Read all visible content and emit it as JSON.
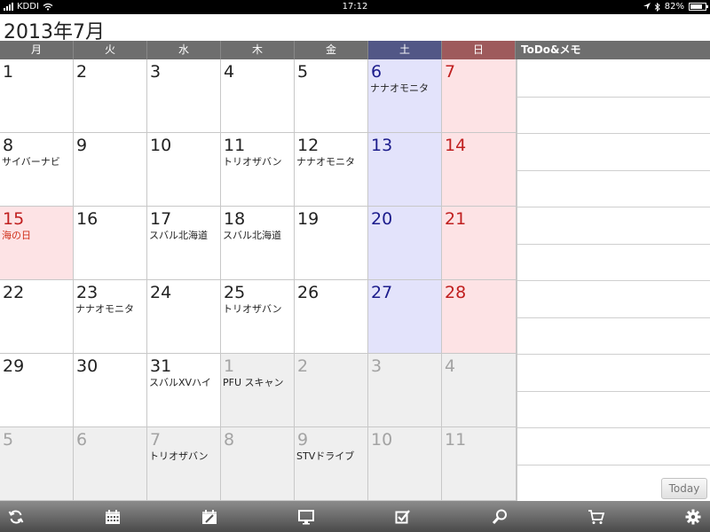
{
  "status_bar": {
    "carrier": "KDDI",
    "time": "17:12",
    "battery": "82%",
    "battery_level": 0.82
  },
  "calendar": {
    "month_title": "2013年7月",
    "weekdays": [
      "月",
      "火",
      "水",
      "木",
      "金",
      "土",
      "日"
    ],
    "memo_header": "ToDo&メモ",
    "weeks": [
      [
        {
          "day": "1",
          "event": ""
        },
        {
          "day": "2",
          "event": ""
        },
        {
          "day": "3",
          "event": ""
        },
        {
          "day": "4",
          "event": ""
        },
        {
          "day": "5",
          "event": ""
        },
        {
          "day": "6",
          "event": "ナナオモニタ"
        },
        {
          "day": "7",
          "event": ""
        }
      ],
      [
        {
          "day": "8",
          "event": "サイバーナビ"
        },
        {
          "day": "9",
          "event": ""
        },
        {
          "day": "10",
          "event": ""
        },
        {
          "day": "11",
          "event": "トリオザバン"
        },
        {
          "day": "12",
          "event": "ナナオモニタ"
        },
        {
          "day": "13",
          "event": ""
        },
        {
          "day": "14",
          "event": ""
        }
      ],
      [
        {
          "day": "15",
          "event": "海の日"
        },
        {
          "day": "16",
          "event": ""
        },
        {
          "day": "17",
          "event": "スバル北海道"
        },
        {
          "day": "18",
          "event": "スバル北海道"
        },
        {
          "day": "19",
          "event": ""
        },
        {
          "day": "20",
          "event": ""
        },
        {
          "day": "21",
          "event": ""
        }
      ],
      [
        {
          "day": "22",
          "event": ""
        },
        {
          "day": "23",
          "event": "ナナオモニタ"
        },
        {
          "day": "24",
          "event": ""
        },
        {
          "day": "25",
          "event": "トリオザバン"
        },
        {
          "day": "26",
          "event": ""
        },
        {
          "day": "27",
          "event": ""
        },
        {
          "day": "28",
          "event": ""
        }
      ],
      [
        {
          "day": "29",
          "event": ""
        },
        {
          "day": "30",
          "event": ""
        },
        {
          "day": "31",
          "event": "スバルXVハイ"
        },
        {
          "day": "1",
          "event": "PFU スキャン"
        },
        {
          "day": "2",
          "event": ""
        },
        {
          "day": "3",
          "event": ""
        },
        {
          "day": "4",
          "event": ""
        }
      ],
      [
        {
          "day": "5",
          "event": ""
        },
        {
          "day": "6",
          "event": ""
        },
        {
          "day": "7",
          "event": "トリオザバン"
        },
        {
          "day": "8",
          "event": ""
        },
        {
          "day": "9",
          "event": "STVドライブ"
        },
        {
          "day": "10",
          "event": ""
        },
        {
          "day": "11",
          "event": ""
        }
      ]
    ]
  },
  "memo": {
    "today_label": "Today"
  },
  "toolbar": {
    "items": [
      "refresh-icon",
      "calendar-month-icon",
      "calendar-edit-icon",
      "display-icon",
      "checkbox-icon",
      "search-icon",
      "cart-icon",
      "gear-icon"
    ]
  },
  "colors": {
    "saturday_header": "#525786",
    "sunday_header": "#9e5a5c",
    "saturday_cell": "#e3e3fb",
    "sunday_cell": "#fde3e5",
    "saturday_text": "#1c1c8c",
    "sunday_text": "#c01f1f"
  }
}
